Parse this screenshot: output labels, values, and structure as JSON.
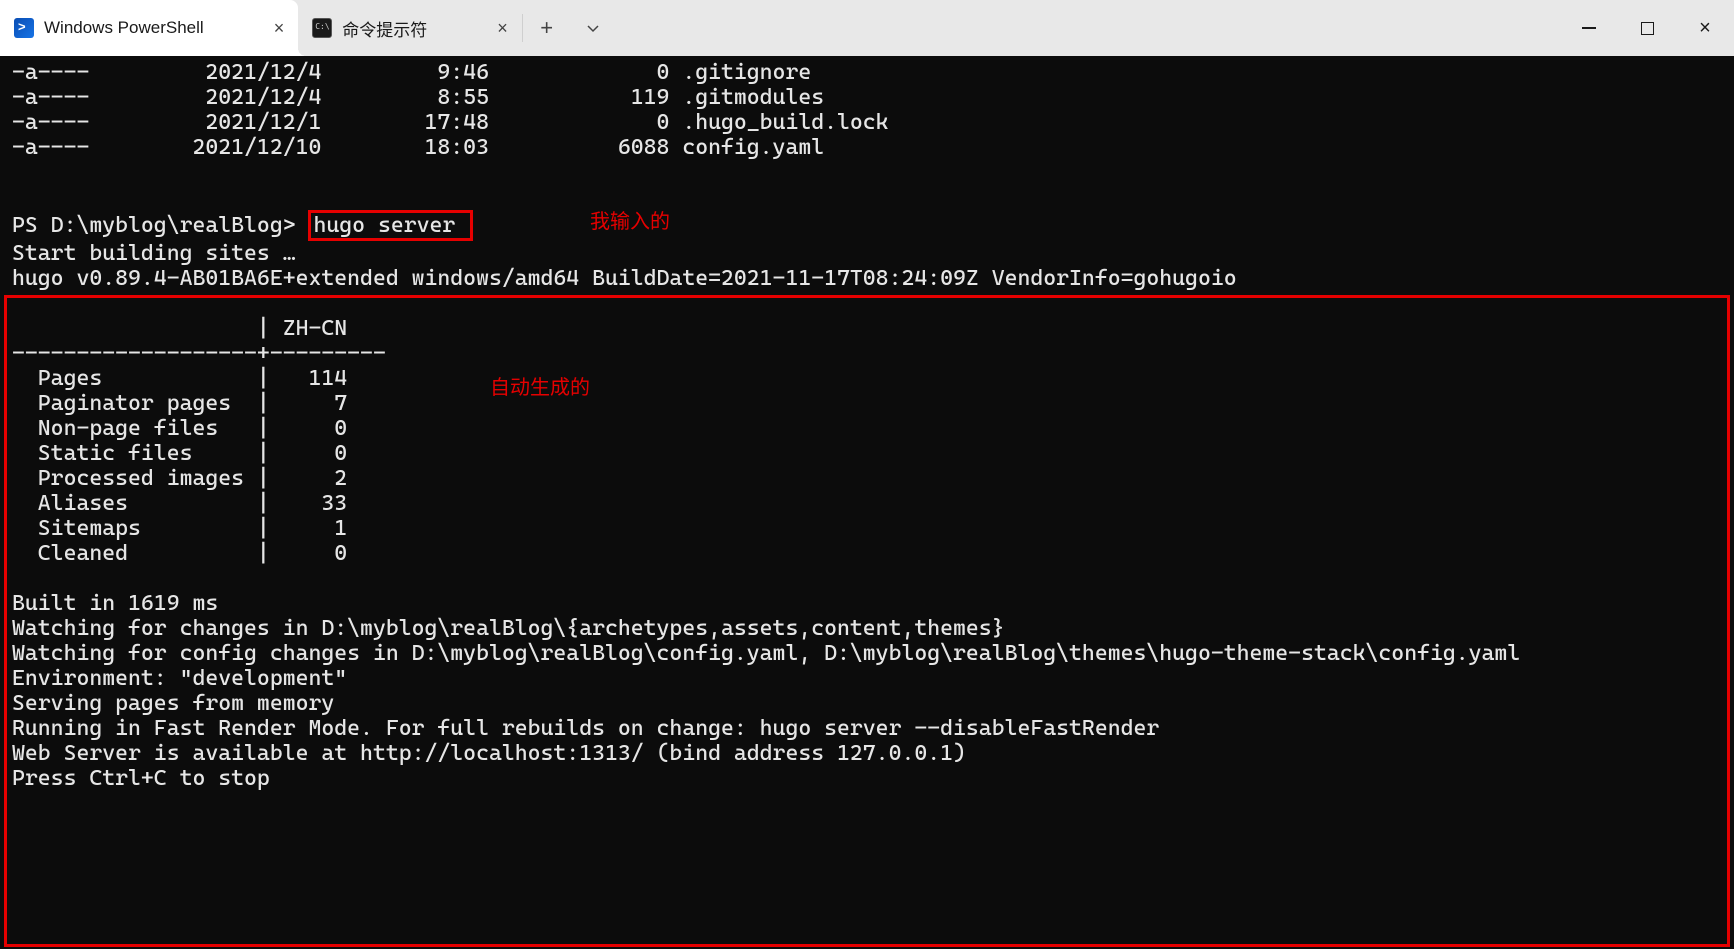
{
  "tabs": {
    "active": {
      "label": "Windows PowerShell"
    },
    "inactive": {
      "label": "命令提示符"
    }
  },
  "annotations": {
    "input": "我输入的",
    "output": "自动生成的"
  },
  "listing": [
    {
      "mode": "-a----",
      "date": "2021/12/4",
      "time": "9:46",
      "size": "0",
      "name": ".gitignore"
    },
    {
      "mode": "-a----",
      "date": "2021/12/4",
      "time": "8:55",
      "size": "119",
      "name": ".gitmodules"
    },
    {
      "mode": "-a----",
      "date": "2021/12/1",
      "time": "17:48",
      "size": "0",
      "name": ".hugo_build.lock"
    },
    {
      "mode": "-a----",
      "date": "2021/12/10",
      "time": "18:03",
      "size": "6088",
      "name": "config.yaml"
    }
  ],
  "prompt": {
    "ps": "PS D:\\myblog\\realBlog>",
    "cmd": "hugo server"
  },
  "hugo": {
    "start": "Start building sites …",
    "version": "hugo v0.89.4-AB01BA6E+extended windows/amd64 BuildDate=2021-11-17T08:24:09Z VendorInfo=gohugoio",
    "table_header_lang": "ZH-CN",
    "stats": [
      {
        "k": "Pages",
        "v": "114"
      },
      {
        "k": "Paginator pages",
        "v": "7"
      },
      {
        "k": "Non-page files",
        "v": "0"
      },
      {
        "k": "Static files",
        "v": "0"
      },
      {
        "k": "Processed images",
        "v": "2"
      },
      {
        "k": "Aliases",
        "v": "33"
      },
      {
        "k": "Sitemaps",
        "v": "1"
      },
      {
        "k": "Cleaned",
        "v": "0"
      }
    ],
    "built": "Built in 1619 ms",
    "watch1": "Watching for changes in D:\\myblog\\realBlog\\{archetypes,assets,content,themes}",
    "watch2": "Watching for config changes in D:\\myblog\\realBlog\\config.yaml, D:\\myblog\\realBlog\\themes\\hugo-theme-stack\\config.yaml",
    "env": "Environment: \"development\"",
    "serve": "Serving pages from memory",
    "fast": "Running in Fast Render Mode. For full rebuilds on change: hugo server --disableFastRender",
    "web": "Web Server is available at http://localhost:1313/ (bind address 127.0.0.1)",
    "stop": "Press Ctrl+C to stop"
  }
}
